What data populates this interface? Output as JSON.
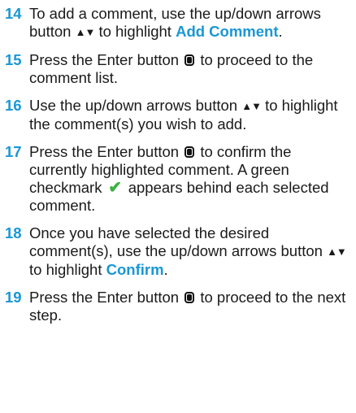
{
  "steps": [
    {
      "number": "14",
      "parts": [
        {
          "t": "text",
          "v": "To add a comment, use the up/down arrows button "
        },
        {
          "t": "icon",
          "v": "up-down-arrows-icon"
        },
        {
          "t": "text",
          "v": " to highlight "
        },
        {
          "t": "hl",
          "v": "Add Comment"
        },
        {
          "t": "text",
          "v": "."
        }
      ]
    },
    {
      "number": "15",
      "parts": [
        {
          "t": "text",
          "v": "Press the Enter button "
        },
        {
          "t": "icon",
          "v": "enter-button-icon"
        },
        {
          "t": "text",
          "v": " to proceed to the comment list."
        }
      ]
    },
    {
      "number": "16",
      "parts": [
        {
          "t": "text",
          "v": "Use the up/down arrows button "
        },
        {
          "t": "icon",
          "v": "up-down-arrows-icon"
        },
        {
          "t": "text",
          "v": " to highlight the comment(s) you wish to add."
        }
      ]
    },
    {
      "number": "17",
      "parts": [
        {
          "t": "text",
          "v": "Press the Enter button "
        },
        {
          "t": "icon",
          "v": "enter-button-icon"
        },
        {
          "t": "text",
          "v": " to confirm the currently highlighted comment. A green checkmark "
        },
        {
          "t": "icon",
          "v": "green-checkmark-icon"
        },
        {
          "t": "text",
          "v": " appears behind each selected comment."
        }
      ]
    },
    {
      "number": "18",
      "parts": [
        {
          "t": "text",
          "v": "Once you have selected the desired comment(s), use the up/down arrows button "
        },
        {
          "t": "icon",
          "v": "up-down-arrows-icon"
        },
        {
          "t": "text",
          "v": " to highlight "
        },
        {
          "t": "hl",
          "v": "Confirm"
        },
        {
          "t": "text",
          "v": "."
        }
      ]
    },
    {
      "number": "19",
      "parts": [
        {
          "t": "text",
          "v": "Press the Enter button "
        },
        {
          "t": "icon",
          "v": "enter-button-icon"
        },
        {
          "t": "text",
          "v": " to proceed to the next step."
        }
      ]
    }
  ],
  "colors": {
    "accent": "#1a97d4",
    "checkmark": "#3cb043",
    "text": "#1a1a1a"
  }
}
